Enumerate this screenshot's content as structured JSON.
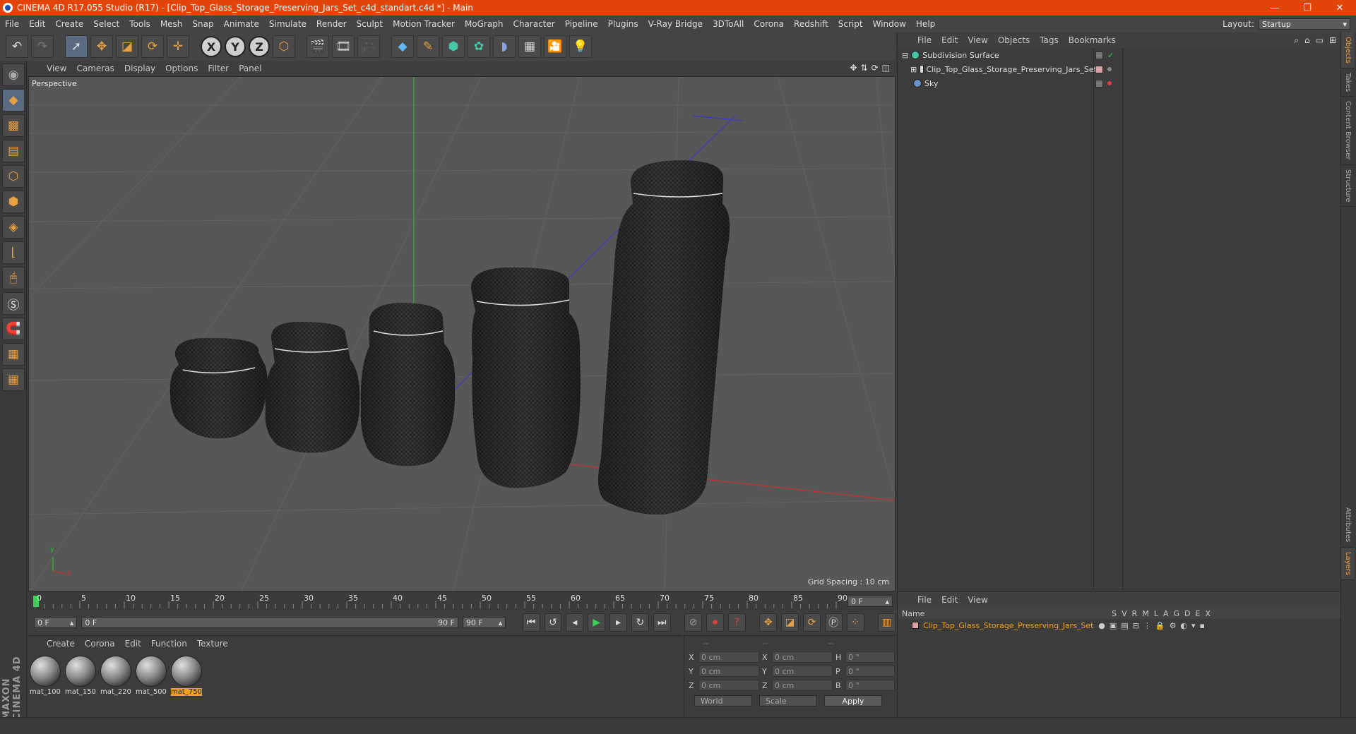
{
  "window": {
    "title": "CINEMA 4D R17.055 Studio (R17) - [Clip_Top_Glass_Storage_Preserving_Jars_Set_c4d_standart.c4d *] - Main",
    "minimize": "—",
    "maximize": "❐",
    "close": "✕"
  },
  "menubar": {
    "items": [
      "File",
      "Edit",
      "Create",
      "Select",
      "Tools",
      "Mesh",
      "Snap",
      "Animate",
      "Simulate",
      "Render",
      "Sculpt",
      "Motion Tracker",
      "MoGraph",
      "Character",
      "Pipeline",
      "Plugins",
      "V-Ray Bridge",
      "3DToAll",
      "Corona",
      "Redshift",
      "Script",
      "Window",
      "Help"
    ],
    "layout_label": "Layout:",
    "layout_value": "Startup"
  },
  "toolbar": {
    "axis_x": "X",
    "axis_y": "Y",
    "axis_z": "Z"
  },
  "viewport": {
    "menu": [
      "View",
      "Cameras",
      "Display",
      "Options",
      "Filter",
      "Panel"
    ],
    "label": "Perspective",
    "grid_spacing": "Grid Spacing : 10 cm",
    "axis_y": "y",
    "axis_x": "x"
  },
  "timeline": {
    "ticks": [
      "0",
      "5",
      "10",
      "15",
      "20",
      "25",
      "30",
      "35",
      "40",
      "45",
      "50",
      "55",
      "60",
      "65",
      "70",
      "75",
      "80",
      "85",
      "90"
    ],
    "current_frame": "0 F",
    "start": "0 F",
    "range_start": "0 F",
    "range_end": "90 F",
    "end": "90 F"
  },
  "materials": {
    "menu": [
      "Create",
      "Corona",
      "Edit",
      "Function",
      "Texture"
    ],
    "items": [
      {
        "name": "mat_100",
        "selected": false
      },
      {
        "name": "mat_150",
        "selected": false
      },
      {
        "name": "mat_220",
        "selected": false
      },
      {
        "name": "mat_500",
        "selected": false
      },
      {
        "name": "mat_750",
        "selected": true
      }
    ]
  },
  "coordinates": {
    "header": [
      "--",
      "--",
      "--"
    ],
    "rows": [
      {
        "l1": "X",
        "v1": "0 cm",
        "l2": "X",
        "v2": "0 cm",
        "l3": "H",
        "v3": "0 °"
      },
      {
        "l1": "Y",
        "v1": "0 cm",
        "l2": "Y",
        "v2": "0 cm",
        "l3": "P",
        "v3": "0 °"
      },
      {
        "l1": "Z",
        "v1": "0 cm",
        "l2": "Z",
        "v2": "0 cm",
        "l3": "B",
        "v3": "0 °"
      }
    ],
    "space": "World",
    "mode": "Scale",
    "apply": "Apply"
  },
  "object_manager": {
    "menu": [
      "File",
      "Edit",
      "View",
      "Objects",
      "Tags",
      "Bookmarks"
    ],
    "objects": [
      {
        "name": "Subdivision Surface",
        "icon": "subdivision-icon"
      },
      {
        "name": "Clip_Top_Glass_Storage_Preserving_Jars_Set",
        "icon": "null-icon"
      },
      {
        "name": "Sky",
        "icon": "sky-icon"
      }
    ]
  },
  "layer_manager": {
    "menu": [
      "File",
      "Edit",
      "View"
    ],
    "name_header": "Name",
    "columns": [
      "S",
      "V",
      "R",
      "M",
      "L",
      "A",
      "G",
      "D",
      "E",
      "X"
    ],
    "layer": "Clip_Top_Glass_Storage_Preserving_Jars_Set"
  },
  "side_tabs": [
    "Objects",
    "Takes",
    "Content Browser",
    "Structure",
    "Attributes",
    "Layers"
  ],
  "branding": "MAXON CINEMA 4D",
  "colors": {
    "accent": "#e2440a",
    "selection": "#f0a020"
  }
}
